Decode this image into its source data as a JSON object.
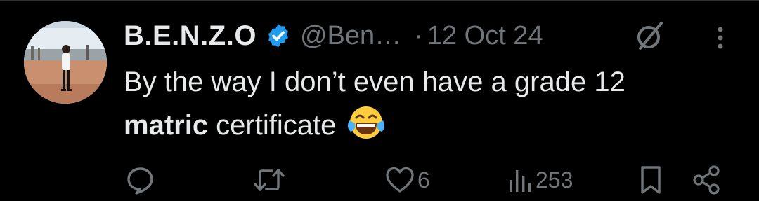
{
  "tweet": {
    "author": {
      "display_name": "B.E.N.Z.O",
      "verified": true,
      "handle": "@Ben…",
      "avatar": "profile-photo"
    },
    "separator": "·",
    "date": "12 Oct 24",
    "text_line1": "By the way I don’t even have a grade 12",
    "text_bold": "matric",
    "text_rest": " certificate",
    "emoji": "face-with-tears-of-joy"
  },
  "actions": {
    "reply": {
      "icon": "reply-icon",
      "count": ""
    },
    "retweet": {
      "icon": "retweet-icon",
      "count": ""
    },
    "like": {
      "icon": "heart-icon",
      "count": "6"
    },
    "views": {
      "icon": "views-chart-icon",
      "count": "253"
    },
    "bookmark": {
      "icon": "bookmark-icon"
    },
    "share": {
      "icon": "share-icon"
    }
  },
  "header_icons": {
    "grok": "grok-icon",
    "more": "more-options-icon"
  },
  "colors": {
    "background": "#000000",
    "primary_text": "#e7e9ea",
    "secondary_text": "#71767b",
    "verified_blue": "#1d9bf0"
  }
}
